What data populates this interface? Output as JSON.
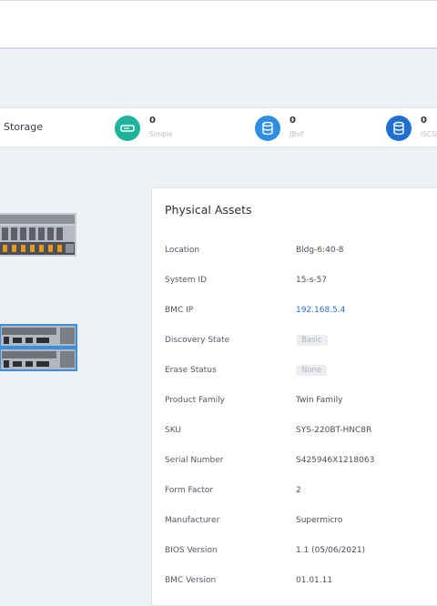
{
  "storage": {
    "title": "Storage",
    "stats": [
      {
        "value": "0",
        "label": "Simple",
        "color": "#1fb39b",
        "icon": "drive-icon"
      },
      {
        "value": "0",
        "label": "JBoF",
        "color": "#2f8de4",
        "icon": "database-icon"
      },
      {
        "value": "0",
        "label": "iSCSI",
        "color": "#1f6fd1",
        "icon": "database-icon"
      }
    ]
  },
  "panel": {
    "title": "Physical Assets",
    "rows": [
      {
        "key": "Location",
        "value": "Bldg-6:40-8"
      },
      {
        "key": "System ID",
        "value": "15-s-57"
      },
      {
        "key": "BMC IP",
        "value": "192.168.5.4"
      },
      {
        "key": "Discovery State",
        "value": "Basic"
      },
      {
        "key": "Erase Status",
        "value": "None"
      },
      {
        "key": "Product Family",
        "value": "Twin Family"
      },
      {
        "key": "SKU",
        "value": "SYS-220BT-HNC8R"
      },
      {
        "key": "Serial Number",
        "value": "S425946X1218063"
      },
      {
        "key": "Form Factor",
        "value": "2"
      },
      {
        "key": "Manufacturer",
        "value": "Supermicro"
      },
      {
        "key": "BIOS Version",
        "value": "1.1 (05/06/2021)"
      },
      {
        "key": "BMC Version",
        "value": "01.01.11"
      }
    ]
  },
  "colors": {
    "accent": "#2b6cd6",
    "teal": "#1fb39b",
    "blue": "#2f8de4"
  }
}
